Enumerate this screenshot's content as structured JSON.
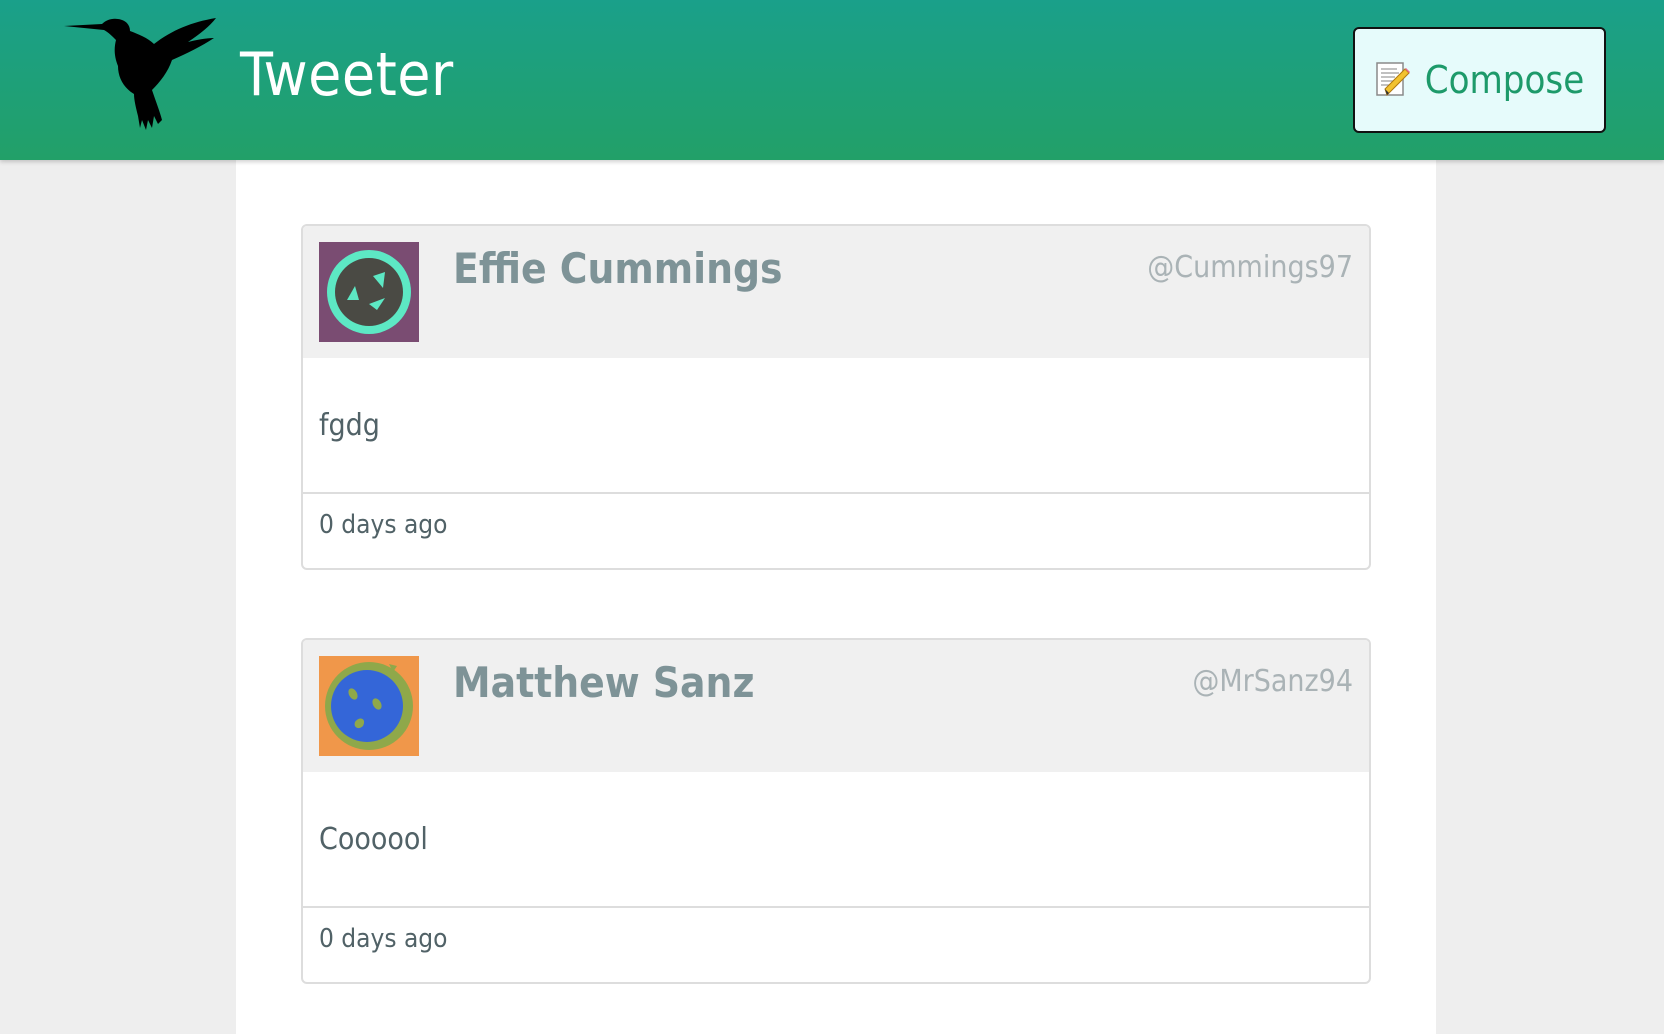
{
  "app": {
    "title": "Tweeter"
  },
  "navbar": {
    "compose_label": "Compose",
    "compose_icon": "memo-pencil-icon",
    "logo_icon": "hummingbird-icon",
    "background_color": "#1aa08a",
    "accent_color": "#1d9a6a"
  },
  "tweets": [
    {
      "name": "Effie Cummings",
      "handle": "@Cummings97",
      "content": "fgdg",
      "time": "0 days ago",
      "avatar_bg": "#7a4c72",
      "avatar_ring": "#5de8c4",
      "avatar_face": "#4a4a44"
    },
    {
      "name": "Matthew Sanz",
      "handle": "@MrSanz94",
      "content": "Coooool",
      "time": "0 days ago",
      "avatar_bg": "#f0974a",
      "avatar_ring": "#8fa84a",
      "avatar_face": "#3466d8"
    }
  ]
}
